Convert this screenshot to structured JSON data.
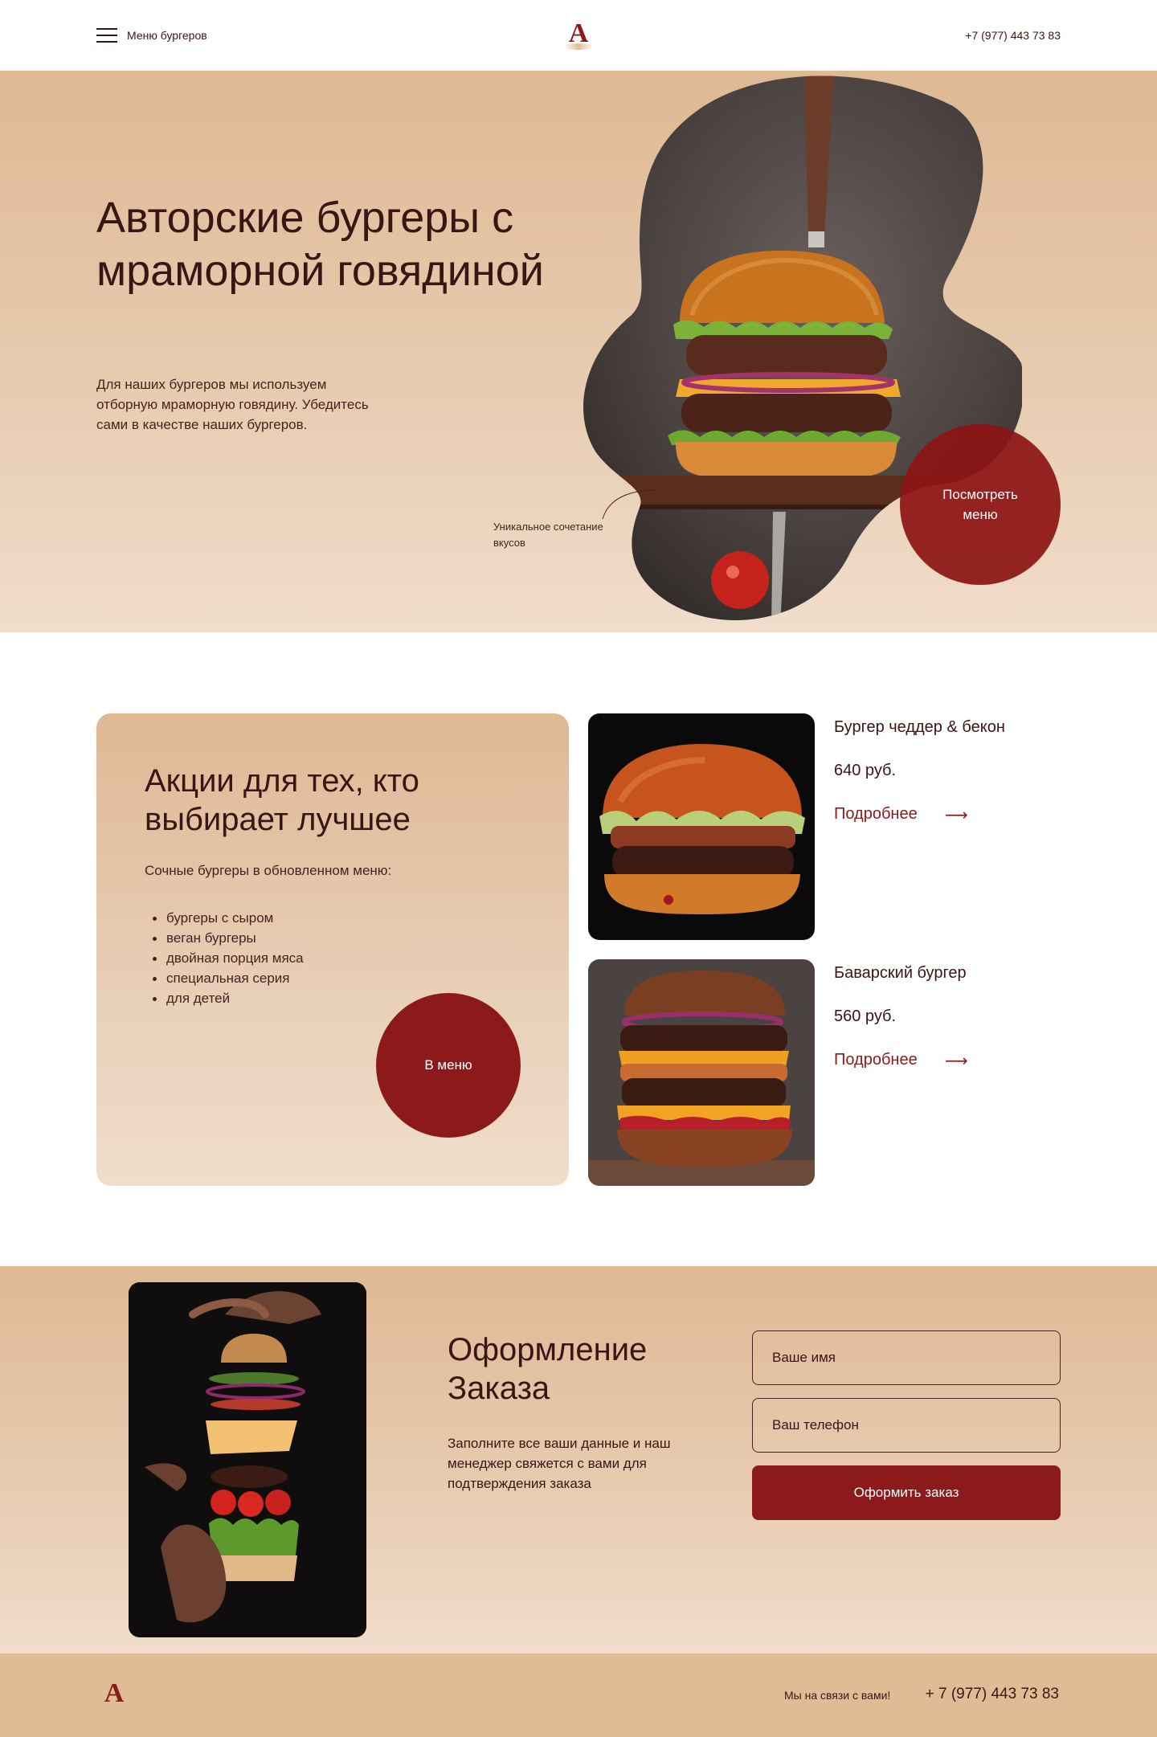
{
  "header": {
    "menu_label": "Меню бургеров",
    "logo_letter": "A",
    "phone": "+7 (977) 443 73 83"
  },
  "hero": {
    "title": "Авторские бургеры с мраморной говядиной",
    "text": "Для наших бургеров мы используем отборную мраморную говядину. Убедитесь сами в качестве наших бургеров.",
    "image_caption": "Уникальное сочетание вкусов",
    "cta_label": "Посмотреть меню"
  },
  "promo": {
    "title": "Акции для тех, кто выбирает лучшее",
    "subtitle": "Сочные бургеры в обновленном меню:",
    "items": [
      "бургеры с сыром",
      "веган бургеры",
      "двойная порция мяса",
      "специальная серия",
      "для детей"
    ],
    "button_label": "В меню"
  },
  "products": [
    {
      "name": "Бургер чеддер & бекон",
      "price": "640 руб.",
      "more_label": "Подробнее",
      "arrow": "⟶"
    },
    {
      "name": "Баварский бургер",
      "price": "560 руб.",
      "more_label": "Подробнее",
      "arrow": "⟶"
    }
  ],
  "order": {
    "title": "Оформление Заказа",
    "text": "Заполните все ваши данные и наш менеджер свяжется с вами для подтверждения заказа",
    "name_placeholder": "Ваше имя",
    "phone_placeholder": "Ваш телефон",
    "submit_label": "Оформить заказ"
  },
  "footer": {
    "logo_letter": "A",
    "note": "Мы на связи с вами!",
    "phone": "+ 7 (977) 443 73 83"
  },
  "colors": {
    "accent": "#8c1a1a",
    "sand": "#dfb894",
    "text": "#3b1414"
  }
}
